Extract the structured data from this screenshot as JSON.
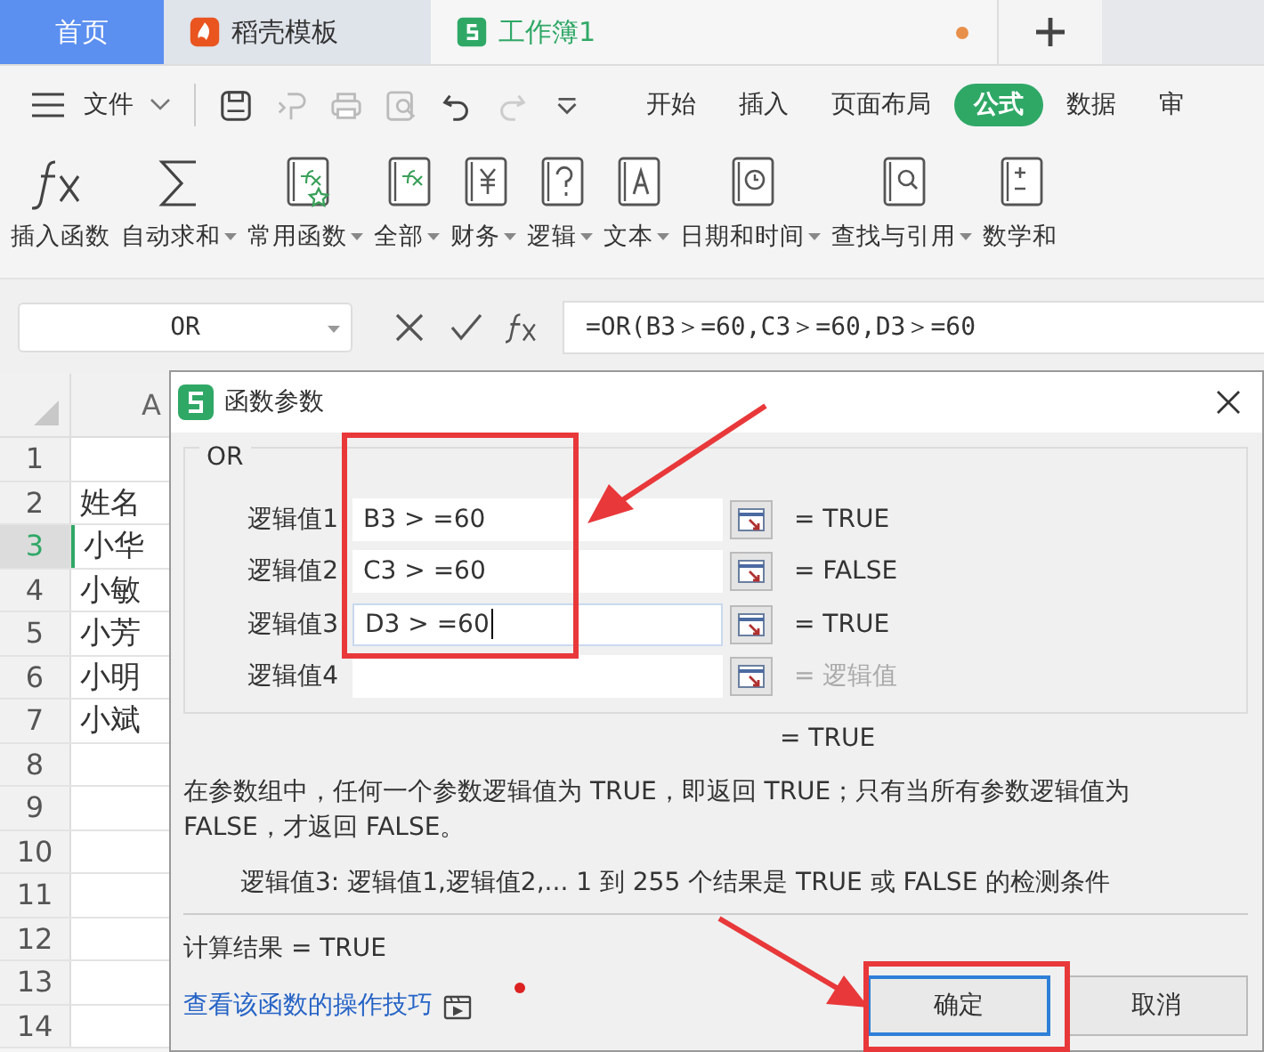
{
  "tabs": [
    {
      "label": "首页",
      "kind": "home",
      "selected": false
    },
    {
      "label": "稻壳模板",
      "kind": "template",
      "selected": false
    },
    {
      "label": "工作簿1",
      "kind": "workbook",
      "selected": true,
      "unsaved": true
    }
  ],
  "menu": {
    "file": "文件",
    "tabs": [
      {
        "label": "开始",
        "selected": false
      },
      {
        "label": "插入",
        "selected": false
      },
      {
        "label": "页面布局",
        "selected": false
      },
      {
        "label": "公式",
        "selected": true
      },
      {
        "label": "数据",
        "selected": false
      },
      {
        "label": "审",
        "selected": false
      }
    ]
  },
  "ribbon": [
    {
      "label": "插入函数",
      "kind": "fx",
      "dropdown": false
    },
    {
      "label": "自动求和",
      "kind": "sum",
      "dropdown": true
    },
    {
      "label": "常用函数",
      "kind": "star",
      "dropdown": true
    },
    {
      "label": "全部",
      "kind": "all",
      "dropdown": true
    },
    {
      "label": "财务",
      "kind": "finance",
      "dropdown": true
    },
    {
      "label": "逻辑",
      "kind": "logic",
      "dropdown": true
    },
    {
      "label": "文本",
      "kind": "text",
      "dropdown": true
    },
    {
      "label": "日期和时间",
      "kind": "clock",
      "dropdown": true
    },
    {
      "label": "查找与引用",
      "kind": "lookup",
      "dropdown": true
    },
    {
      "label": "数学和",
      "kind": "math",
      "dropdown": false
    }
  ],
  "formula_bar": {
    "name_box": "OR",
    "formula": "=OR(B3＞=60,C3＞=60,D3＞=60"
  },
  "sheet": {
    "column": "A",
    "rows": [
      {
        "number": "1",
        "cell": "",
        "selected": false
      },
      {
        "number": "2",
        "cell": "姓名",
        "selected": false
      },
      {
        "number": "3",
        "cell": "小华",
        "selected": true
      },
      {
        "number": "4",
        "cell": "小敏",
        "selected": false
      },
      {
        "number": "5",
        "cell": "小芳",
        "selected": false
      },
      {
        "number": "6",
        "cell": "小明",
        "selected": false
      },
      {
        "number": "7",
        "cell": "小斌",
        "selected": false
      },
      {
        "number": "8",
        "cell": "",
        "selected": false
      },
      {
        "number": "9",
        "cell": "",
        "selected": false
      },
      {
        "number": "10",
        "cell": "",
        "selected": false
      },
      {
        "number": "11",
        "cell": "",
        "selected": false
      },
      {
        "number": "12",
        "cell": "",
        "selected": false
      },
      {
        "number": "13",
        "cell": "",
        "selected": false
      },
      {
        "number": "14",
        "cell": "",
        "selected": false
      }
    ]
  },
  "dialog": {
    "title": "函数参数",
    "function": "OR",
    "args": [
      {
        "label": "逻辑值1",
        "value": "B3 > =60",
        "result": "= TRUE",
        "muted": false,
        "focused": false
      },
      {
        "label": "逻辑值2",
        "value": "C3 > =60",
        "result": "= FALSE",
        "muted": false,
        "focused": false
      },
      {
        "label": "逻辑值3",
        "value": "D3 > =60",
        "result": "= TRUE",
        "muted": false,
        "focused": true
      },
      {
        "label": "逻辑值4",
        "result": "= 逻辑值",
        "muted": true,
        "focused": false
      }
    ],
    "overall": "= TRUE",
    "description": "在参数组中，任何一个参数逻辑值为 TRUE，即返回 TRUE；只有当所有参数逻辑值为 FALSE，才返回 FALSE。",
    "arg_help": "逻辑值3:  逻辑值1,逻辑值2,... 1 到 255 个结果是 TRUE 或 FALSE 的检测条件",
    "result": "计算结果  =  TRUE",
    "link": "查看该函数的操作技巧",
    "buttons": [
      {
        "label": "确定",
        "kind": "primary"
      },
      {
        "label": "取消",
        "kind": "normal"
      }
    ]
  }
}
